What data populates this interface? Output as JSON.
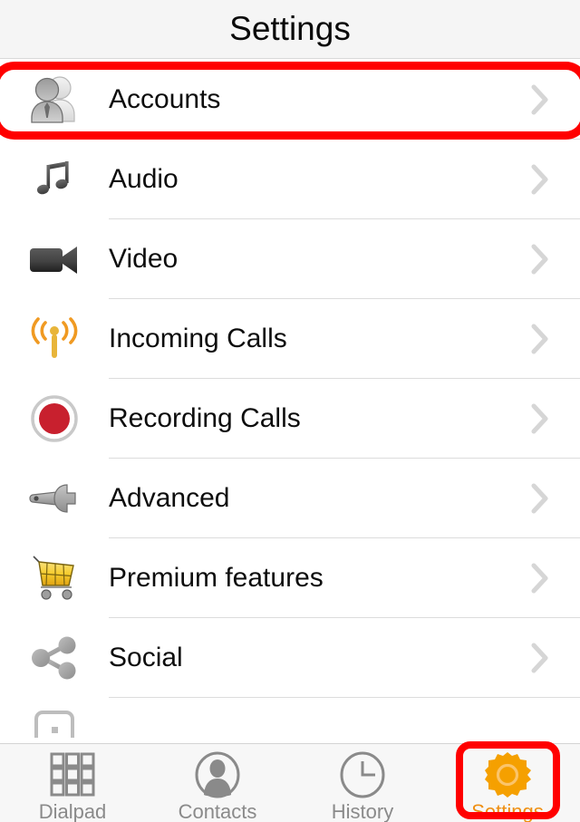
{
  "header": {
    "title": "Settings"
  },
  "list": {
    "items": [
      {
        "label": "Accounts",
        "icon": "two-people-icon",
        "chevron": "chevron-right-icon",
        "highlighted": true
      },
      {
        "label": "Audio",
        "icon": "music-note-icon",
        "chevron": "chevron-right-icon"
      },
      {
        "label": "Video",
        "icon": "video-camera-icon",
        "chevron": "chevron-right-icon"
      },
      {
        "label": "Incoming Calls",
        "icon": "antenna-signal-icon",
        "chevron": "chevron-right-icon"
      },
      {
        "label": "Recording Calls",
        "icon": "record-button-icon",
        "chevron": "chevron-right-icon"
      },
      {
        "label": "Advanced",
        "icon": "wrench-icon",
        "chevron": "chevron-right-icon"
      },
      {
        "label": "Premium features",
        "icon": "shopping-cart-icon",
        "chevron": "chevron-right-icon"
      },
      {
        "label": "Social",
        "icon": "share-nodes-icon",
        "chevron": "chevron-right-icon"
      },
      {
        "label": "",
        "icon": "device-icon",
        "chevron": ""
      }
    ]
  },
  "tabbar": {
    "tabs": [
      {
        "label": "Dialpad",
        "icon": "dialpad-grid-icon",
        "active": false
      },
      {
        "label": "Contacts",
        "icon": "person-circle-icon",
        "active": false
      },
      {
        "label": "History",
        "icon": "clock-icon",
        "active": false
      },
      {
        "label": "Settings",
        "icon": "gear-icon",
        "active": true
      }
    ]
  },
  "annotations": {
    "color": "#ff0000",
    "targets": [
      "Accounts",
      "Settings"
    ]
  },
  "colors": {
    "accent_orange": "#ef8f12",
    "annotation_red": "#ff0000",
    "header_background": "#f5f5f5",
    "tabbar_background": "#f7f7f7",
    "inactive_gray": "#8a8a8a",
    "separator": "#dcdcdc",
    "chevron": "#d6d6d6",
    "record_red": "#c8202e",
    "cart_gold": "#f0c419"
  }
}
